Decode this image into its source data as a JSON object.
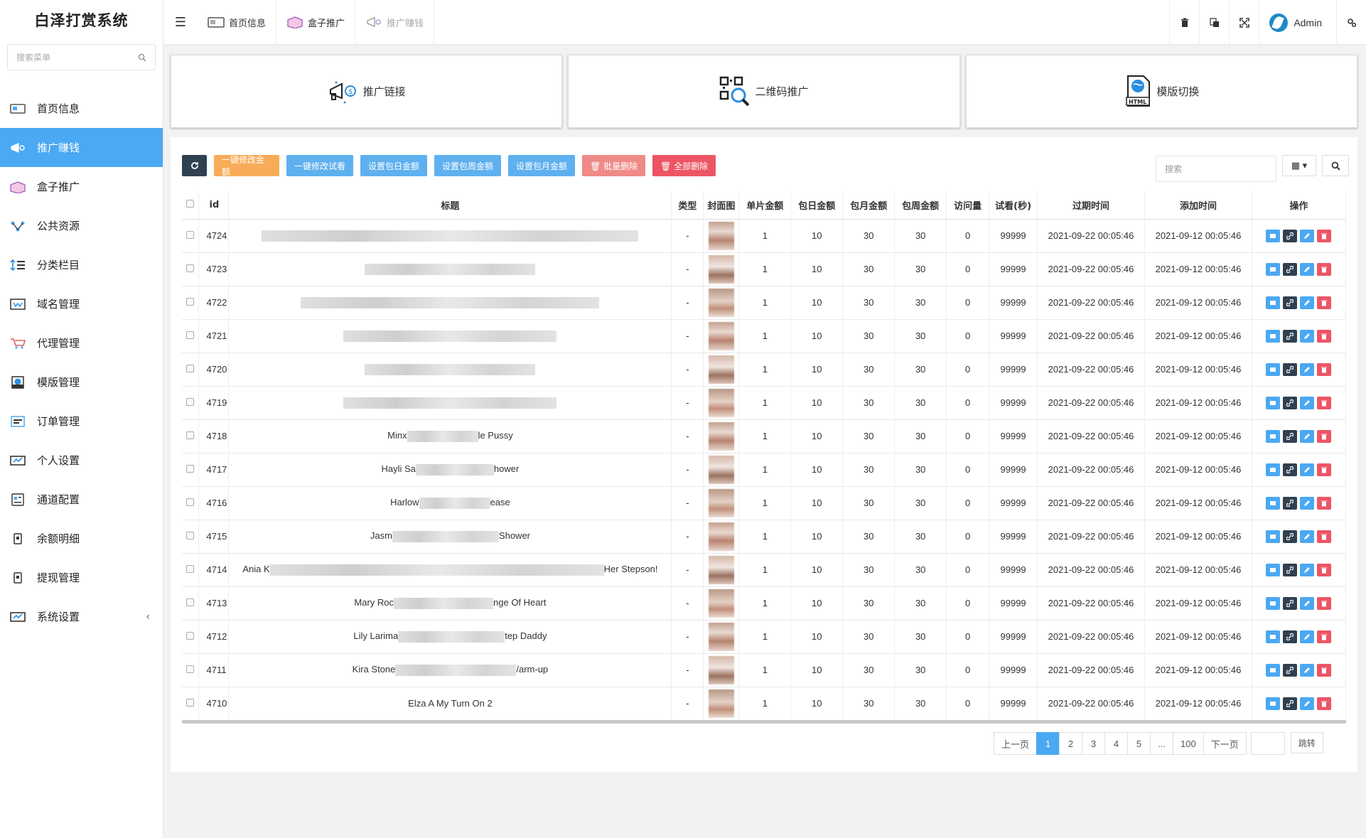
{
  "app": {
    "title": "白泽打赏系统"
  },
  "sidebar": {
    "search_placeholder": "搜索菜单",
    "items": [
      {
        "label": "首页信息",
        "icon": "home-screen-icon",
        "active": false
      },
      {
        "label": "推广赚钱",
        "icon": "megaphone-icon",
        "active": true
      },
      {
        "label": "盒子推广",
        "icon": "box-icon",
        "active": false
      },
      {
        "label": "公共资源",
        "icon": "network-icon",
        "active": false
      },
      {
        "label": "分类栏目",
        "icon": "list-icon",
        "active": false
      },
      {
        "label": "域名管理",
        "icon": "domain-icon",
        "active": false
      },
      {
        "label": "代理管理",
        "icon": "cart-icon",
        "active": false
      },
      {
        "label": "模版管理",
        "icon": "html-icon",
        "active": false
      },
      {
        "label": "订单管理",
        "icon": "order-icon",
        "active": false
      },
      {
        "label": "个人设置",
        "icon": "profile-icon",
        "active": false
      },
      {
        "label": "通道配置",
        "icon": "channel-icon",
        "active": false
      },
      {
        "label": "余额明细",
        "icon": "wallet-icon",
        "active": false
      },
      {
        "label": "提现管理",
        "icon": "withdraw-icon",
        "active": false
      },
      {
        "label": "系统设置",
        "icon": "settings-icon",
        "active": false,
        "arrow": "‹"
      }
    ]
  },
  "topbar": {
    "tabs": [
      {
        "label": "首页信息",
        "dim": false
      },
      {
        "label": "盒子推广",
        "dim": false
      },
      {
        "label": "推广赚钱",
        "dim": true
      }
    ],
    "user": "Admin"
  },
  "cards": [
    {
      "label": "推广链接",
      "icon": "megaphone-icon"
    },
    {
      "label": "二维码推广",
      "icon": "qrcode-search-icon"
    },
    {
      "label": "模版切换",
      "icon": "html-template-icon"
    }
  ],
  "toolbar": {
    "buttons": [
      {
        "label": "",
        "style": "tb-dark",
        "icon": "refresh-icon"
      },
      {
        "label": "一键修改金额",
        "style": "tb-yellow"
      },
      {
        "label": "一键修改试看",
        "style": "tb-blue"
      },
      {
        "label": "设置包日金额",
        "style": "tb-blue"
      },
      {
        "label": "设置包周金额",
        "style": "tb-blue"
      },
      {
        "label": "设置包月金额",
        "style": "tb-blue"
      },
      {
        "label": "🗑 批量删除",
        "style": "tb-pink"
      },
      {
        "label": "🗑 全部删除",
        "style": "tb-red"
      }
    ],
    "search_placeholder": "搜索"
  },
  "table": {
    "headers": [
      "id",
      "标题",
      "类型",
      "封面图",
      "单片金额",
      "包日金额",
      "包月金额",
      "包周金额",
      "访问量",
      "试看(秒)",
      "过期时间",
      "添加时间",
      "操作"
    ],
    "rows": [
      {
        "id": "4724",
        "title_l": "",
        "title_r": "",
        "blur": 530,
        "type": "-",
        "single": "1",
        "day": "10",
        "month": "30",
        "week": "30",
        "visits": "0",
        "trial": "99999",
        "expire": "2021-09-22 00:05:46",
        "added": "2021-09-12 00:05:46"
      },
      {
        "id": "4723",
        "title_l": "",
        "title_r": "",
        "blur": 240,
        "type": "-",
        "single": "1",
        "day": "10",
        "month": "30",
        "week": "30",
        "visits": "0",
        "trial": "99999",
        "expire": "2021-09-22 00:05:46",
        "added": "2021-09-12 00:05:46"
      },
      {
        "id": "4722",
        "title_l": "",
        "title_r": "",
        "blur": 420,
        "type": "-",
        "single": "1",
        "day": "10",
        "month": "30",
        "week": "30",
        "visits": "0",
        "trial": "99999",
        "expire": "2021-09-22 00:05:46",
        "added": "2021-09-12 00:05:46"
      },
      {
        "id": "4721",
        "title_l": "",
        "title_r": "",
        "blur": 300,
        "type": "-",
        "single": "1",
        "day": "10",
        "month": "30",
        "week": "30",
        "visits": "0",
        "trial": "99999",
        "expire": "2021-09-22 00:05:46",
        "added": "2021-09-12 00:05:46"
      },
      {
        "id": "4720",
        "title_l": "",
        "title_r": "",
        "blur": 240,
        "type": "-",
        "single": "1",
        "day": "10",
        "month": "30",
        "week": "30",
        "visits": "0",
        "trial": "99999",
        "expire": "2021-09-22 00:05:46",
        "added": "2021-09-12 00:05:46"
      },
      {
        "id": "4719",
        "title_l": "",
        "title_r": "",
        "blur": 300,
        "type": "-",
        "single": "1",
        "day": "10",
        "month": "30",
        "week": "30",
        "visits": "0",
        "trial": "99999",
        "expire": "2021-09-22 00:05:46",
        "added": "2021-09-12 00:05:46"
      },
      {
        "id": "4718",
        "title_l": "Minx",
        "title_r": "le Pussy",
        "blur": 100,
        "type": "-",
        "single": "1",
        "day": "10",
        "month": "30",
        "week": "30",
        "visits": "0",
        "trial": "99999",
        "expire": "2021-09-22 00:05:46",
        "added": "2021-09-12 00:05:46"
      },
      {
        "id": "4717",
        "title_l": "Hayli Sa",
        "title_r": "hower",
        "blur": 110,
        "type": "-",
        "single": "1",
        "day": "10",
        "month": "30",
        "week": "30",
        "visits": "0",
        "trial": "99999",
        "expire": "2021-09-22 00:05:46",
        "added": "2021-09-12 00:05:46"
      },
      {
        "id": "4716",
        "title_l": "Harlow",
        "title_r": "ease",
        "blur": 100,
        "type": "-",
        "single": "1",
        "day": "10",
        "month": "30",
        "week": "30",
        "visits": "0",
        "trial": "99999",
        "expire": "2021-09-22 00:05:46",
        "added": "2021-09-12 00:05:46"
      },
      {
        "id": "4715",
        "title_l": "Jasm",
        "title_r": "Shower",
        "blur": 150,
        "type": "-",
        "single": "1",
        "day": "10",
        "month": "30",
        "week": "30",
        "visits": "0",
        "trial": "99999",
        "expire": "2021-09-22 00:05:46",
        "added": "2021-09-12 00:05:46"
      },
      {
        "id": "4714",
        "title_l": "Ania K",
        "title_r": "Her Stepson!",
        "blur": 470,
        "type": "-",
        "single": "1",
        "day": "10",
        "month": "30",
        "week": "30",
        "visits": "0",
        "trial": "99999",
        "expire": "2021-09-22 00:05:46",
        "added": "2021-09-12 00:05:46"
      },
      {
        "id": "4713",
        "title_l": "Mary Roc",
        "title_r": "nge Of Heart",
        "blur": 140,
        "type": "-",
        "single": "1",
        "day": "10",
        "month": "30",
        "week": "30",
        "visits": "0",
        "trial": "99999",
        "expire": "2021-09-22 00:05:46",
        "added": "2021-09-12 00:05:46"
      },
      {
        "id": "4712",
        "title_l": "Lily Larima",
        "title_r": "tep Daddy",
        "blur": 150,
        "type": "-",
        "single": "1",
        "day": "10",
        "month": "30",
        "week": "30",
        "visits": "0",
        "trial": "99999",
        "expire": "2021-09-22 00:05:46",
        "added": "2021-09-12 00:05:46"
      },
      {
        "id": "4711",
        "title_l": "Kira Stone",
        "title_r": "/arm-up",
        "blur": 170,
        "type": "-",
        "single": "1",
        "day": "10",
        "month": "30",
        "week": "30",
        "visits": "0",
        "trial": "99999",
        "expire": "2021-09-22 00:05:46",
        "added": "2021-09-12 00:05:46"
      },
      {
        "id": "4710",
        "title_l": "Elza A My Turn On 2",
        "title_r": "",
        "blur": 0,
        "type": "-",
        "single": "1",
        "day": "10",
        "month": "30",
        "week": "30",
        "visits": "0",
        "trial": "99999",
        "expire": "2021-09-22 00:05:46",
        "added": "2021-09-12 00:05:46"
      }
    ]
  },
  "pagination": {
    "prev": "上一页",
    "pages": [
      "1",
      "2",
      "3",
      "4",
      "5",
      "...",
      "100"
    ],
    "current": "1",
    "next": "下一页",
    "go": "跳转"
  },
  "colors": {
    "accent": "#4ba8f2",
    "dark": "#2f4050",
    "danger": "#ed5565",
    "warning": "#f8ac59"
  }
}
